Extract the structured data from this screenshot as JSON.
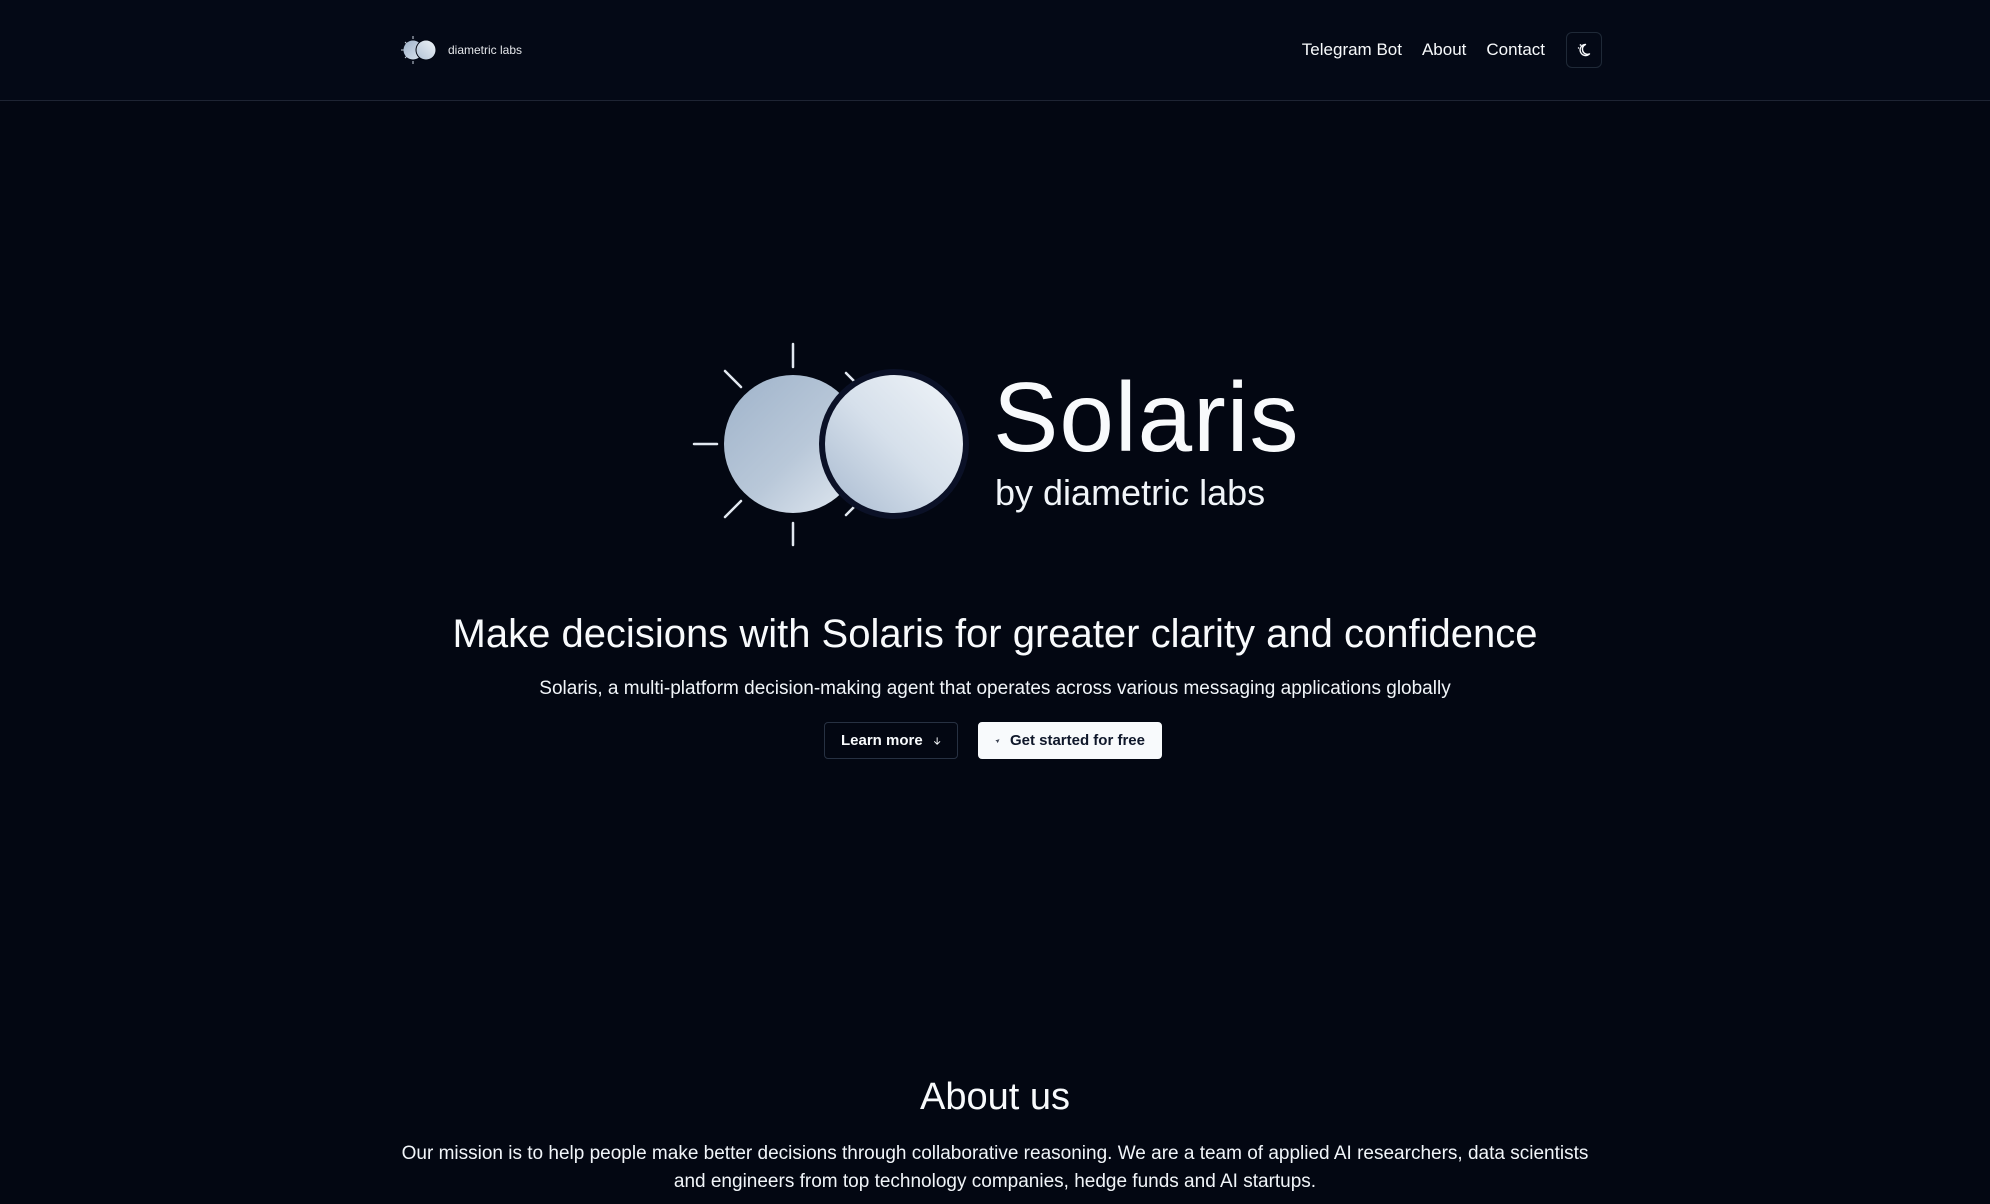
{
  "header": {
    "brand_name": "diametric labs",
    "nav": [
      "Telegram Bot",
      "About",
      "Contact"
    ],
    "theme_toggle_icon": "moon-sun-icon"
  },
  "hero": {
    "title": "Solaris",
    "subtitle": "by diametric labs",
    "headline": "Make decisions with Solaris for greater clarity and confidence",
    "tagline": "Solaris, a multi-platform decision-making agent that operates across various messaging applications globally",
    "learn_more_label": "Learn more",
    "learn_more_icon": "arrow-down-icon",
    "get_started_label": "Get started for free",
    "get_started_icon": "send-icon"
  },
  "about": {
    "title": "About us",
    "body": "Our mission is to help people make better decisions through collaborative reasoning. We are a team of applied AI researchers, data scientists and engineers from top technology companies, hedge funds and AI startups."
  },
  "colors": {
    "background": "#030712",
    "text": "#f8fafc",
    "logo_left": "#a9bbd1",
    "logo_right": "#dde6f0"
  }
}
